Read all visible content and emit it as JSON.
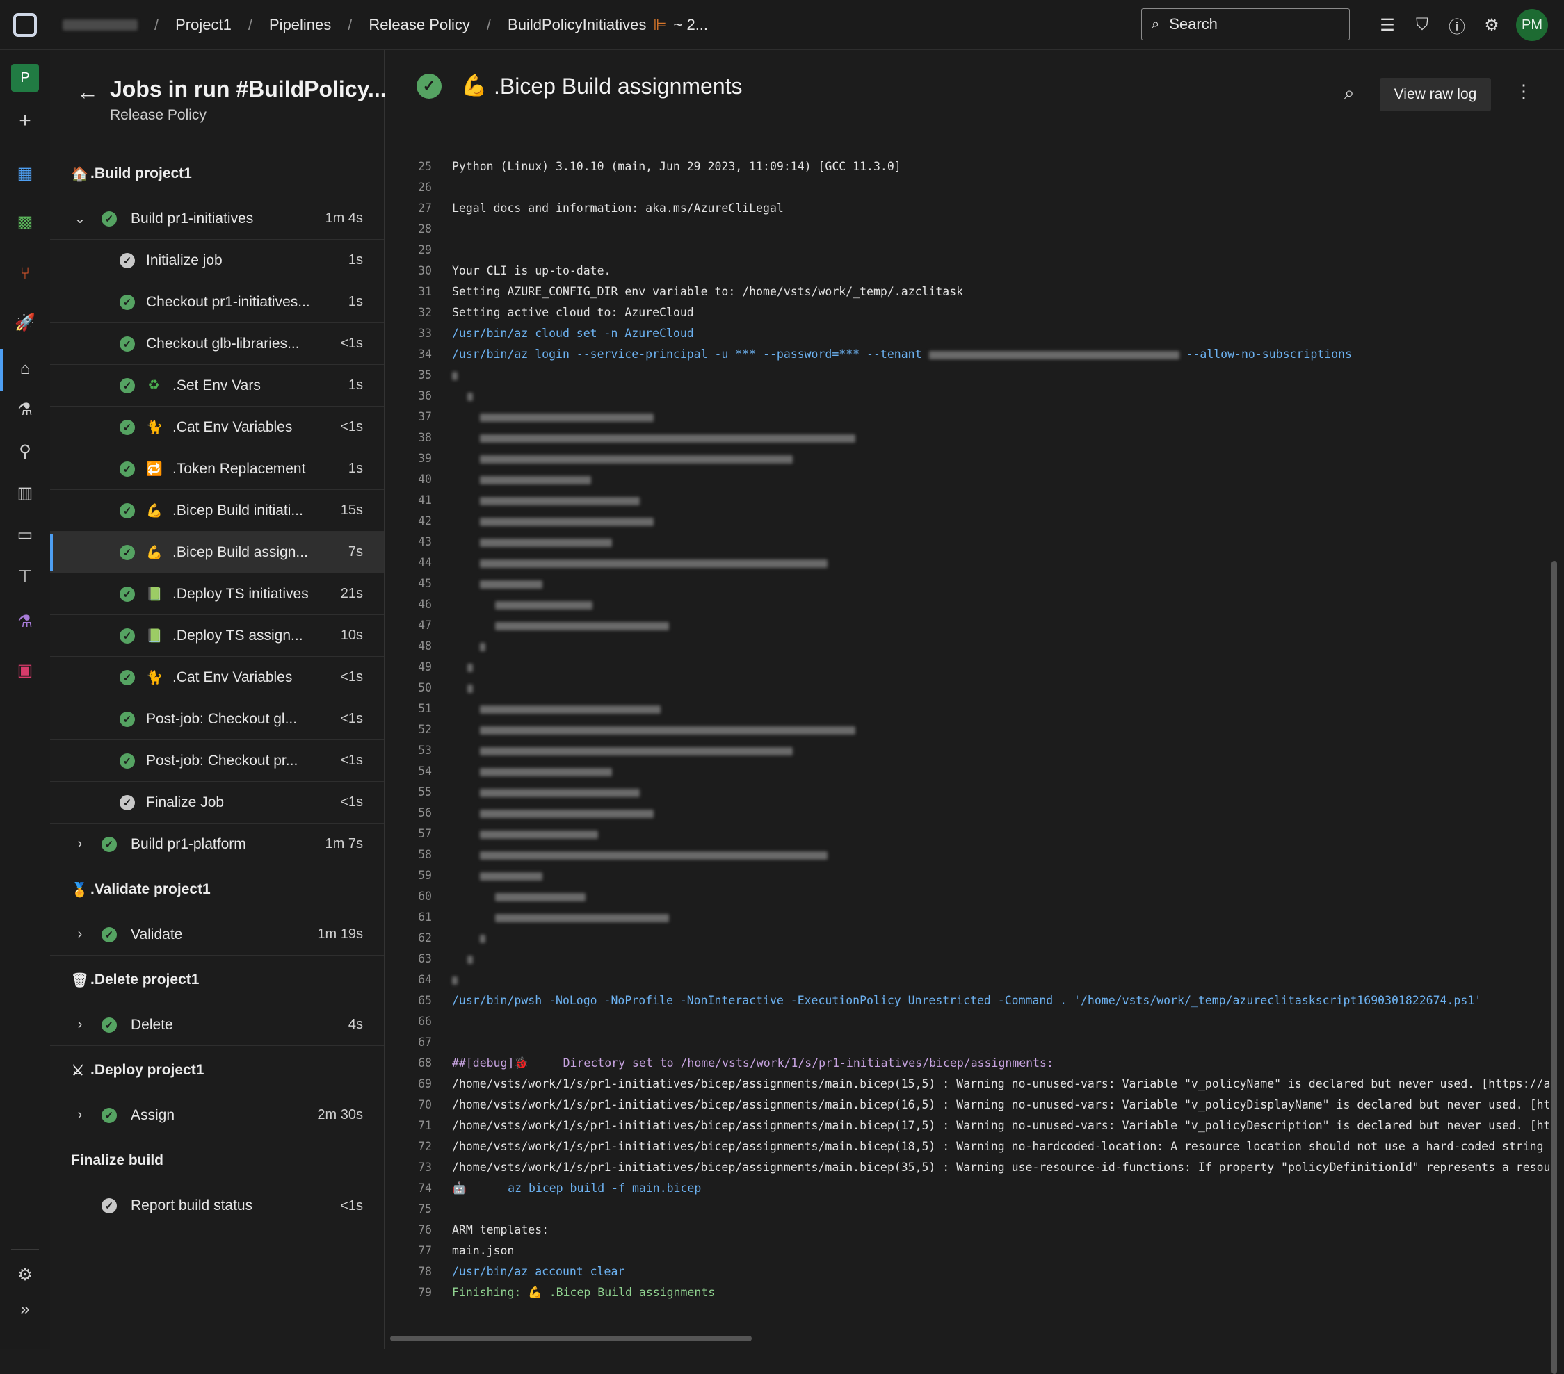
{
  "topbar": {
    "breadcrumbs": [
      "Project1",
      "Pipelines",
      "Release Policy",
      "BuildPolicyInitiatives"
    ],
    "run_label": "~ 2...",
    "search_placeholder": "Search",
    "avatar_initials": "PM"
  },
  "rail": {
    "project_initial": "P"
  },
  "jobs_panel": {
    "title": "Jobs in run #BuildPolicy...",
    "subtitle": "Release Policy",
    "stages": [
      {
        "label": ".Build project1",
        "icon": "house-icon"
      },
      {
        "label": ".Validate project1",
        "icon": "medal-icon"
      },
      {
        "label": ".Delete project1",
        "icon": "trash-icon"
      },
      {
        "label": ".Deploy project1",
        "icon": "swords-icon"
      },
      {
        "label": "Finalize build"
      }
    ],
    "jobs": [
      {
        "name": "Build pr1-initiatives",
        "duration": "1m 4s",
        "expanded": true
      },
      {
        "name": "Build pr1-platform",
        "duration": "1m 7s",
        "expanded": false
      },
      {
        "name": "Validate",
        "duration": "1m 19s",
        "expanded": false
      },
      {
        "name": "Delete",
        "duration": "4s",
        "expanded": false
      },
      {
        "name": "Assign",
        "duration": "2m 30s",
        "expanded": false
      }
    ],
    "steps": [
      {
        "name": "Initialize job",
        "duration": "1s",
        "status": "neutral"
      },
      {
        "name": "Checkout pr1-initiatives...",
        "duration": "1s",
        "status": "success"
      },
      {
        "name": "Checkout glb-libraries...",
        "duration": "<1s",
        "status": "success"
      },
      {
        "name": ".Set Env Vars",
        "duration": "1s",
        "status": "success",
        "icon": "recycle-icon"
      },
      {
        "name": ".Cat Env Variables",
        "duration": "<1s",
        "status": "success",
        "icon": "cat-icon"
      },
      {
        "name": ".Token Replacement",
        "duration": "1s",
        "status": "success",
        "icon": "replace-icon"
      },
      {
        "name": ".Bicep Build initiati...",
        "duration": "15s",
        "status": "success",
        "icon": "muscle-icon"
      },
      {
        "name": ".Bicep Build assign...",
        "duration": "7s",
        "status": "success",
        "icon": "muscle-icon",
        "selected": true
      },
      {
        "name": ".Deploy TS initiatives",
        "duration": "21s",
        "status": "success",
        "icon": "book-icon"
      },
      {
        "name": ".Deploy TS assign...",
        "duration": "10s",
        "status": "success",
        "icon": "book-icon"
      },
      {
        "name": ".Cat Env Variables",
        "duration": "<1s",
        "status": "success",
        "icon": "cat-icon"
      },
      {
        "name": "Post-job: Checkout gl...",
        "duration": "<1s",
        "status": "success"
      },
      {
        "name": "Post-job: Checkout pr...",
        "duration": "<1s",
        "status": "success"
      },
      {
        "name": "Finalize Job",
        "duration": "<1s",
        "status": "neutral"
      }
    ],
    "final_step": {
      "name": "Report build status",
      "duration": "<1s",
      "status": "neutral"
    }
  },
  "log": {
    "title": ".Bicep Build assignments",
    "raw_button": "View raw log",
    "lines": [
      {
        "n": "25",
        "t": "Python (Linux) 3.10.10 (main, Jun 29 2023, 11:09:14) [GCC 11.3.0]"
      },
      {
        "n": "26",
        "t": ""
      },
      {
        "n": "27",
        "t": "Legal docs and information: aka.ms/AzureCliLegal"
      },
      {
        "n": "28",
        "t": ""
      },
      {
        "n": "29",
        "t": ""
      },
      {
        "n": "30",
        "t": "Your CLI is up-to-date."
      },
      {
        "n": "31",
        "t": "Setting AZURE_CONFIG_DIR env variable to: /home/vsts/work/_temp/.azclitask"
      },
      {
        "n": "32",
        "t": "Setting active cloud to: AzureCloud"
      },
      {
        "n": "33",
        "t": "/usr/bin/az cloud set -n AzureCloud",
        "kind": "cmd"
      },
      {
        "n": "34",
        "t": "/usr/bin/az login --service-principal -u *** --password=*** --tenant",
        "kind": "cmd",
        "tail": "--allow-no-subscriptions"
      },
      {
        "n": "35",
        "t": ""
      },
      {
        "n": "36",
        "t": ""
      },
      {
        "n": "37",
        "t": ""
      },
      {
        "n": "38",
        "t": ""
      },
      {
        "n": "39",
        "t": ""
      },
      {
        "n": "40",
        "t": ""
      },
      {
        "n": "41",
        "t": ""
      },
      {
        "n": "42",
        "t": ""
      },
      {
        "n": "43",
        "t": ""
      },
      {
        "n": "44",
        "t": ""
      },
      {
        "n": "45",
        "t": ""
      },
      {
        "n": "46",
        "t": ""
      },
      {
        "n": "47",
        "t": ""
      },
      {
        "n": "48",
        "t": ""
      },
      {
        "n": "49",
        "t": ""
      },
      {
        "n": "50",
        "t": ""
      },
      {
        "n": "51",
        "t": ""
      },
      {
        "n": "52",
        "t": ""
      },
      {
        "n": "53",
        "t": ""
      },
      {
        "n": "54",
        "t": ""
      },
      {
        "n": "55",
        "t": ""
      },
      {
        "n": "56",
        "t": ""
      },
      {
        "n": "57",
        "t": ""
      },
      {
        "n": "58",
        "t": ""
      },
      {
        "n": "59",
        "t": ""
      },
      {
        "n": "60",
        "t": ""
      },
      {
        "n": "61",
        "t": ""
      },
      {
        "n": "62",
        "t": ""
      },
      {
        "n": "63",
        "t": ""
      },
      {
        "n": "64",
        "t": ""
      },
      {
        "n": "65",
        "t": "/usr/bin/pwsh -NoLogo -NoProfile -NonInteractive -ExecutionPolicy Unrestricted -Command . '/home/vsts/work/_temp/azureclitaskscript1690301822674.ps1'",
        "kind": "cmd"
      },
      {
        "n": "66",
        "t": ""
      },
      {
        "n": "67",
        "t": ""
      },
      {
        "n": "68",
        "t": "##[debug]🐞     Directory set to /home/vsts/work/1/s/pr1-initiatives/bicep/assignments:",
        "kind": "dbg"
      },
      {
        "n": "69",
        "t": "/home/vsts/work/1/s/pr1-initiatives/bicep/assignments/main.bicep(15,5) : Warning no-unused-vars: Variable \"v_policyName\" is declared but never used. [https://a"
      },
      {
        "n": "70",
        "t": "/home/vsts/work/1/s/pr1-initiatives/bicep/assignments/main.bicep(16,5) : Warning no-unused-vars: Variable \"v_policyDisplayName\" is declared but never used. [ht"
      },
      {
        "n": "71",
        "t": "/home/vsts/work/1/s/pr1-initiatives/bicep/assignments/main.bicep(17,5) : Warning no-unused-vars: Variable \"v_policyDescription\" is declared but never used. [ht"
      },
      {
        "n": "72",
        "t": "/home/vsts/work/1/s/pr1-initiatives/bicep/assignments/main.bicep(18,5) : Warning no-hardcoded-location: A resource location should not use a hard-coded string"
      },
      {
        "n": "73",
        "t": "/home/vsts/work/1/s/pr1-initiatives/bicep/assignments/main.bicep(35,5) : Warning use-resource-id-functions: If property \"policyDefinitionId\" represents a resou"
      },
      {
        "n": "74",
        "t": "🤖      az bicep build -f main.bicep",
        "kind": "cmd"
      },
      {
        "n": "75",
        "t": ""
      },
      {
        "n": "76",
        "t": "ARM templates:"
      },
      {
        "n": "77",
        "t": "main.json"
      },
      {
        "n": "78",
        "t": "/usr/bin/az account clear",
        "kind": "cmd"
      },
      {
        "n": "79",
        "t": "Finishing: 💪 .Bicep Build assignments",
        "kind": "fin"
      }
    ]
  },
  "colors": {
    "success": "#55a362",
    "accent": "#4e9ff2",
    "command_text": "#6cb1f0"
  }
}
